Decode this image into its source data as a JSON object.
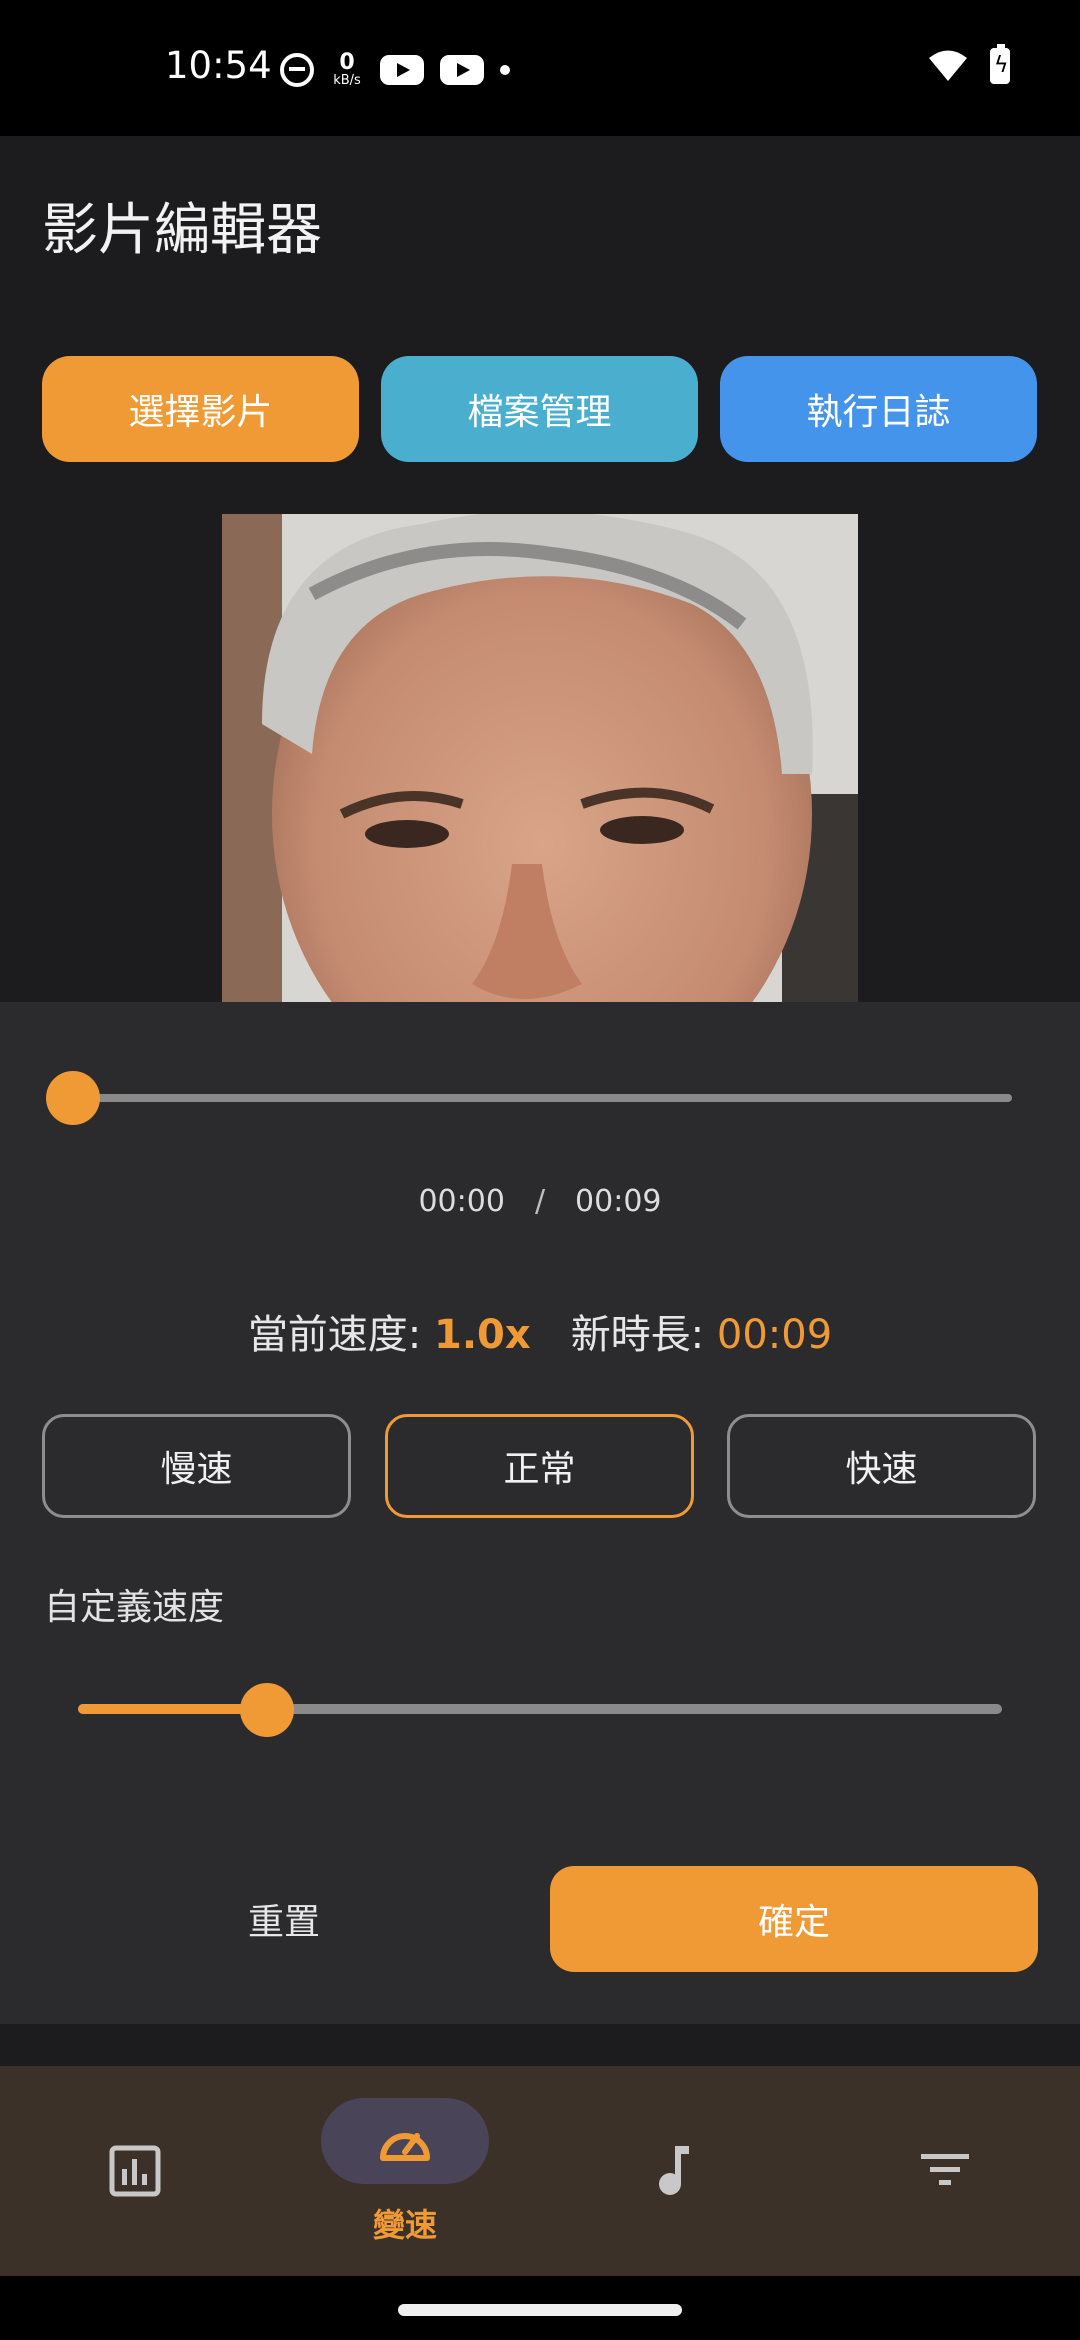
{
  "status_bar": {
    "time": "10:54",
    "net_speed_value": "0",
    "net_speed_unit": "kB/s",
    "icons": [
      "face-icon",
      "net-speed",
      "youtube-icon",
      "youtube-icon",
      "dot",
      "wifi-icon",
      "battery-charging-icon"
    ]
  },
  "header": {
    "title": "影片編輯器"
  },
  "top_buttons": {
    "select_video": "選擇影片",
    "file_manager": "檔案管理",
    "run_log": "執行日誌"
  },
  "colors": {
    "accent": "#f09a36",
    "files_button": "#4aafcf",
    "log_button": "#4594ec",
    "panel": "#2b2b2e",
    "nav_bar": "#3b3129"
  },
  "player": {
    "current_time": "00:00",
    "separator": "/",
    "total_time": "00:09",
    "progress": 0
  },
  "speed_info": {
    "current_speed_label": "當前速度:",
    "current_speed_value": "1.0x",
    "new_duration_label": "新時長:",
    "new_duration_value": "00:09"
  },
  "presets": {
    "slow": "慢速",
    "normal": "正常",
    "fast": "快速",
    "selected": "normal"
  },
  "custom_speed": {
    "label": "自定義速度",
    "slider_fraction": 0.2
  },
  "actions": {
    "reset": "重置",
    "confirm": "確定"
  },
  "bottom_nav": {
    "items": [
      {
        "icon": "bar-chart-icon",
        "label": ""
      },
      {
        "icon": "speedometer-icon",
        "label": "變速",
        "selected": true
      },
      {
        "icon": "music-note-icon",
        "label": ""
      },
      {
        "icon": "filter-icon",
        "label": ""
      }
    ]
  }
}
